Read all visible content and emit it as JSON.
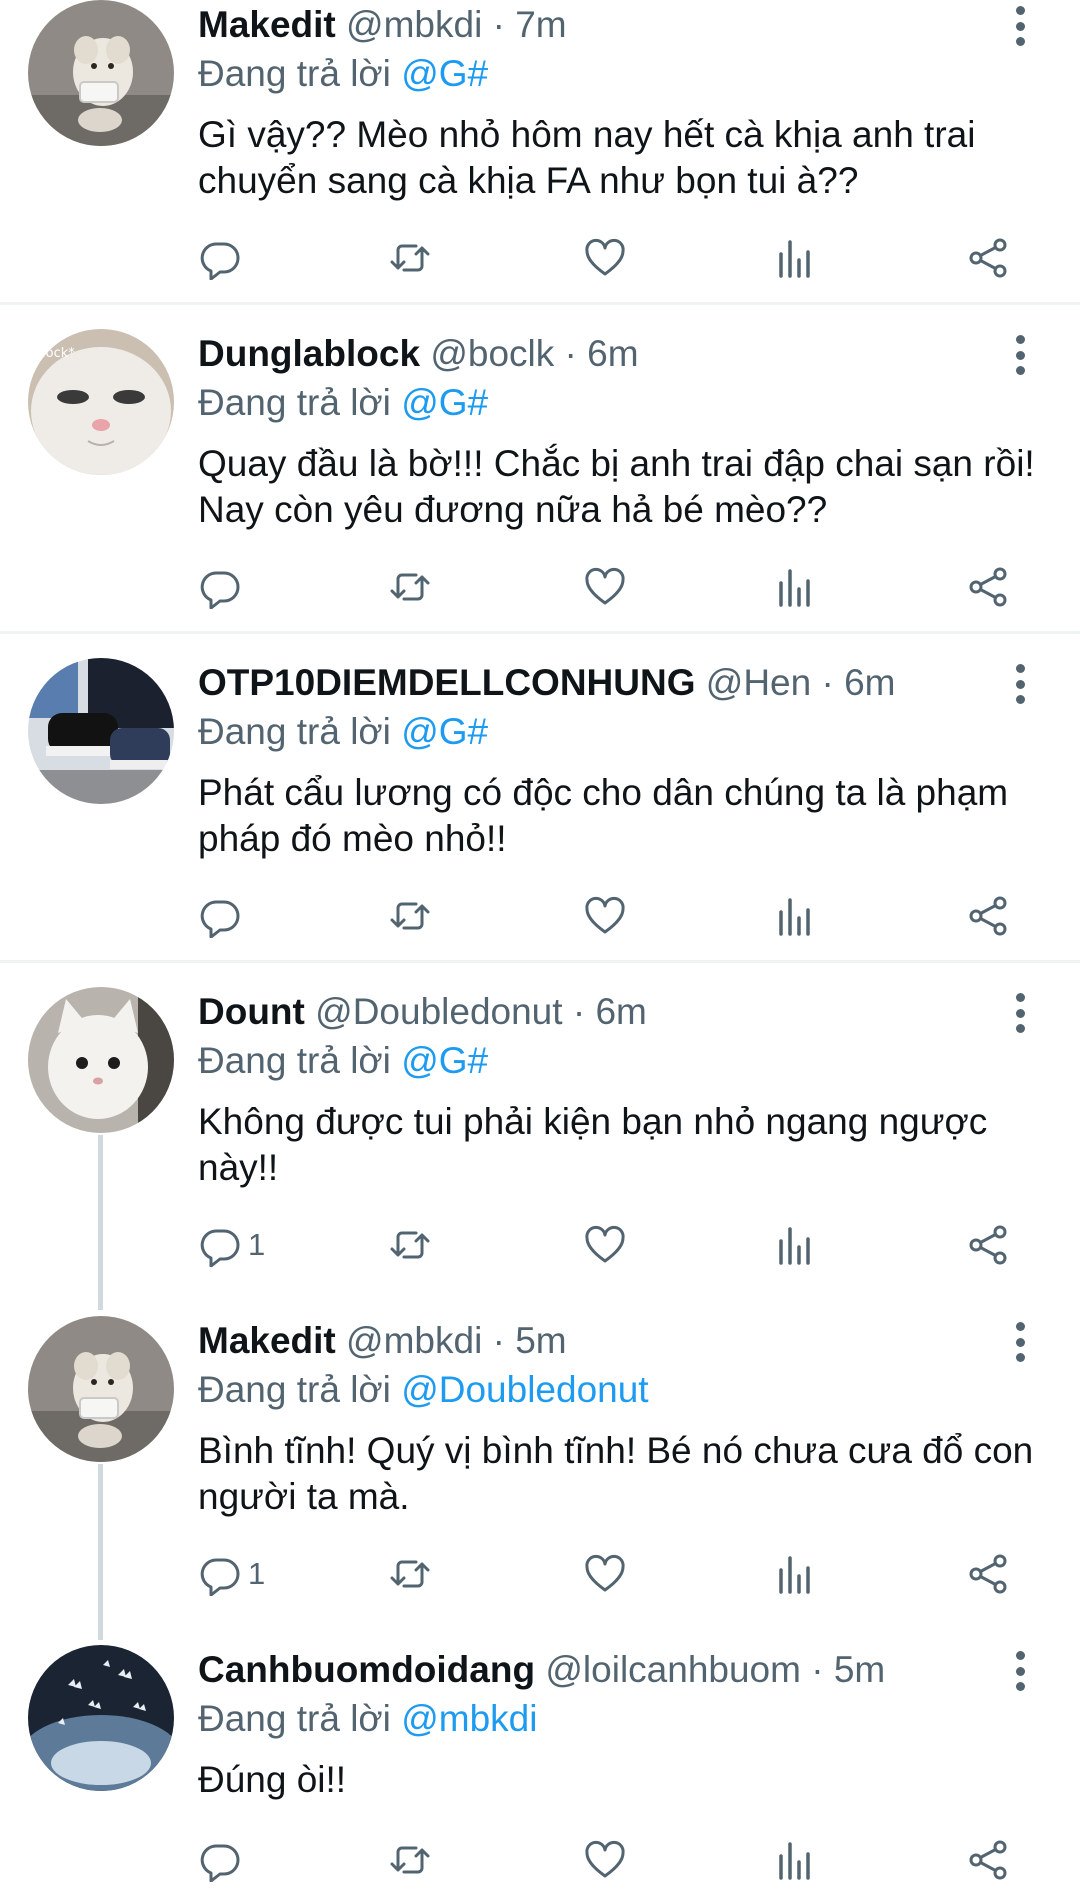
{
  "tweets": [
    {
      "name": "Makedit",
      "handle": "@mbkdi",
      "separator": "·",
      "time": "7m",
      "reply_prefix": "Đang trả lời",
      "reply_to": "@G#",
      "text": "Gì vậy?? Mèo nhỏ hôm nay hết cà khịa anh trai chuyển sang cà khịa FA như bọn tui à??",
      "reply_count": "",
      "avatar": "white-puppy-avatar"
    },
    {
      "name": "Dunglablock",
      "handle": "@boclk",
      "separator": "·",
      "time": "6m",
      "reply_prefix": "Đang trả lời",
      "reply_to": "@G#",
      "text": "Quay đầu là bờ!!! Chắc bị anh trai đập chai sạn rồi! Nay còn yêu đương nữa hả bé mèo??",
      "reply_count": "",
      "avatar": "white-cat-closeup-avatar",
      "avatar_caption": "lock*"
    },
    {
      "name": "OTP10DIEMDELLCONHUNG",
      "handle": "@Hen",
      "separator": "·",
      "time": "6m",
      "reply_prefix": "Đang trả lời",
      "reply_to": "@G#",
      "text": "Phát cẩu lương có độc cho dân chúng ta là phạm pháp đó mèo nhỏ!!",
      "reply_count": "",
      "avatar": "sneakers-photo-avatar"
    },
    {
      "name": "Dount",
      "handle": "@Doubledonut",
      "separator": "·",
      "time": "6m",
      "reply_prefix": "Đang trả lời",
      "reply_to": "@G#",
      "text": "Không được tui phải kiện bạn nhỏ ngang ngược này!!",
      "reply_count": "1",
      "avatar": "white-kitten-avatar"
    },
    {
      "name": "Makedit",
      "handle": "@mbkdi",
      "separator": "·",
      "time": "5m",
      "reply_prefix": "Đang trả lời",
      "reply_to": "@Doubledonut",
      "text": "Bình tĩnh! Quý vị bình tĩnh! Bé nó chưa cưa đổ con người ta mà.",
      "reply_count": "1",
      "avatar": "white-puppy-avatar"
    },
    {
      "name": "Canhbuomdoidang",
      "handle": "@loilcanhbuom",
      "separator": "·",
      "time": "5m",
      "reply_prefix": "Đang trả lời",
      "reply_to": "@mbkdi",
      "text": "Đúng òi!!",
      "reply_count": "",
      "avatar": "butterflies-night-avatar"
    }
  ],
  "icons": {
    "reply": "reply-icon",
    "retweet": "retweet-icon",
    "like": "heart-icon",
    "stats": "analytics-icon",
    "share": "share-icon",
    "more": "more-vertical-icon"
  },
  "colors": {
    "text": "#0f1419",
    "secondary": "#536471",
    "link": "#1d9bf0",
    "divider": "#eff3f4",
    "thread_line": "#cfd9de"
  }
}
